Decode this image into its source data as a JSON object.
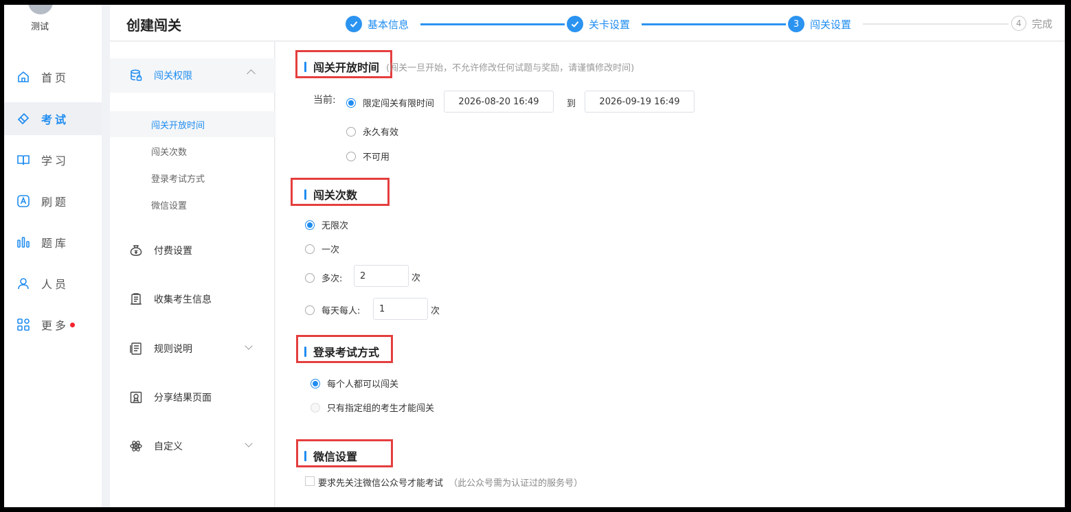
{
  "user": {
    "name": "测试"
  },
  "nav": [
    {
      "label": "首页",
      "icon": "home-icon"
    },
    {
      "label": "考试",
      "icon": "eraser-icon",
      "active": true
    },
    {
      "label": "学习",
      "icon": "book-icon"
    },
    {
      "label": "刷题",
      "icon": "letter-a-icon"
    },
    {
      "label": "题库",
      "icon": "bars-icon"
    },
    {
      "label": "人员",
      "icon": "person-icon"
    },
    {
      "label": "更多",
      "icon": "apps-icon",
      "badge": true
    }
  ],
  "header": {
    "title": "创建闯关",
    "steps": [
      {
        "label": "基本信息",
        "state": "done"
      },
      {
        "label": "关卡设置",
        "state": "done"
      },
      {
        "label": "闯关设置",
        "num": "3",
        "state": "current"
      },
      {
        "label": "完成",
        "num": "4",
        "state": "todo"
      }
    ]
  },
  "submenu": {
    "group": "闯关权限",
    "group_items": [
      "闯关开放时间",
      "闯关次数",
      "登录考试方式",
      "微信设置"
    ],
    "items": [
      "付费设置",
      "收集考生信息",
      "规则说明",
      "分享结果页面",
      "自定义"
    ]
  },
  "open_time": {
    "title": "闯关开放时间",
    "hint": "(闯关一旦开始，不允许修改任何试题与奖励，请谨慎修改时间)",
    "current_label": "当前:",
    "options": [
      "限定闯关有限时间",
      "永久有效",
      "不可用"
    ],
    "start": "2026-08-20 16:49",
    "to": "到",
    "end": "2026-09-19 16:49"
  },
  "attempts": {
    "title": "闯关次数",
    "options": [
      "无限次",
      "一次",
      "多次:",
      "每天每人:"
    ],
    "multi_value": "2",
    "daily_value": "1",
    "unit": "次"
  },
  "login": {
    "title": "登录考试方式",
    "options": [
      "每个人都可以闯关",
      "只有指定组的考生才能闯关"
    ]
  },
  "wechat": {
    "title": "微信设置",
    "checkbox_label": "要求先关注微信公众号才能考试",
    "checkbox_hint": "（此公众号需为认证过的服务号）"
  },
  "colors": {
    "accent": "#1f8cf0",
    "highlight": "#e53e3e",
    "badge": "#f5222d"
  }
}
